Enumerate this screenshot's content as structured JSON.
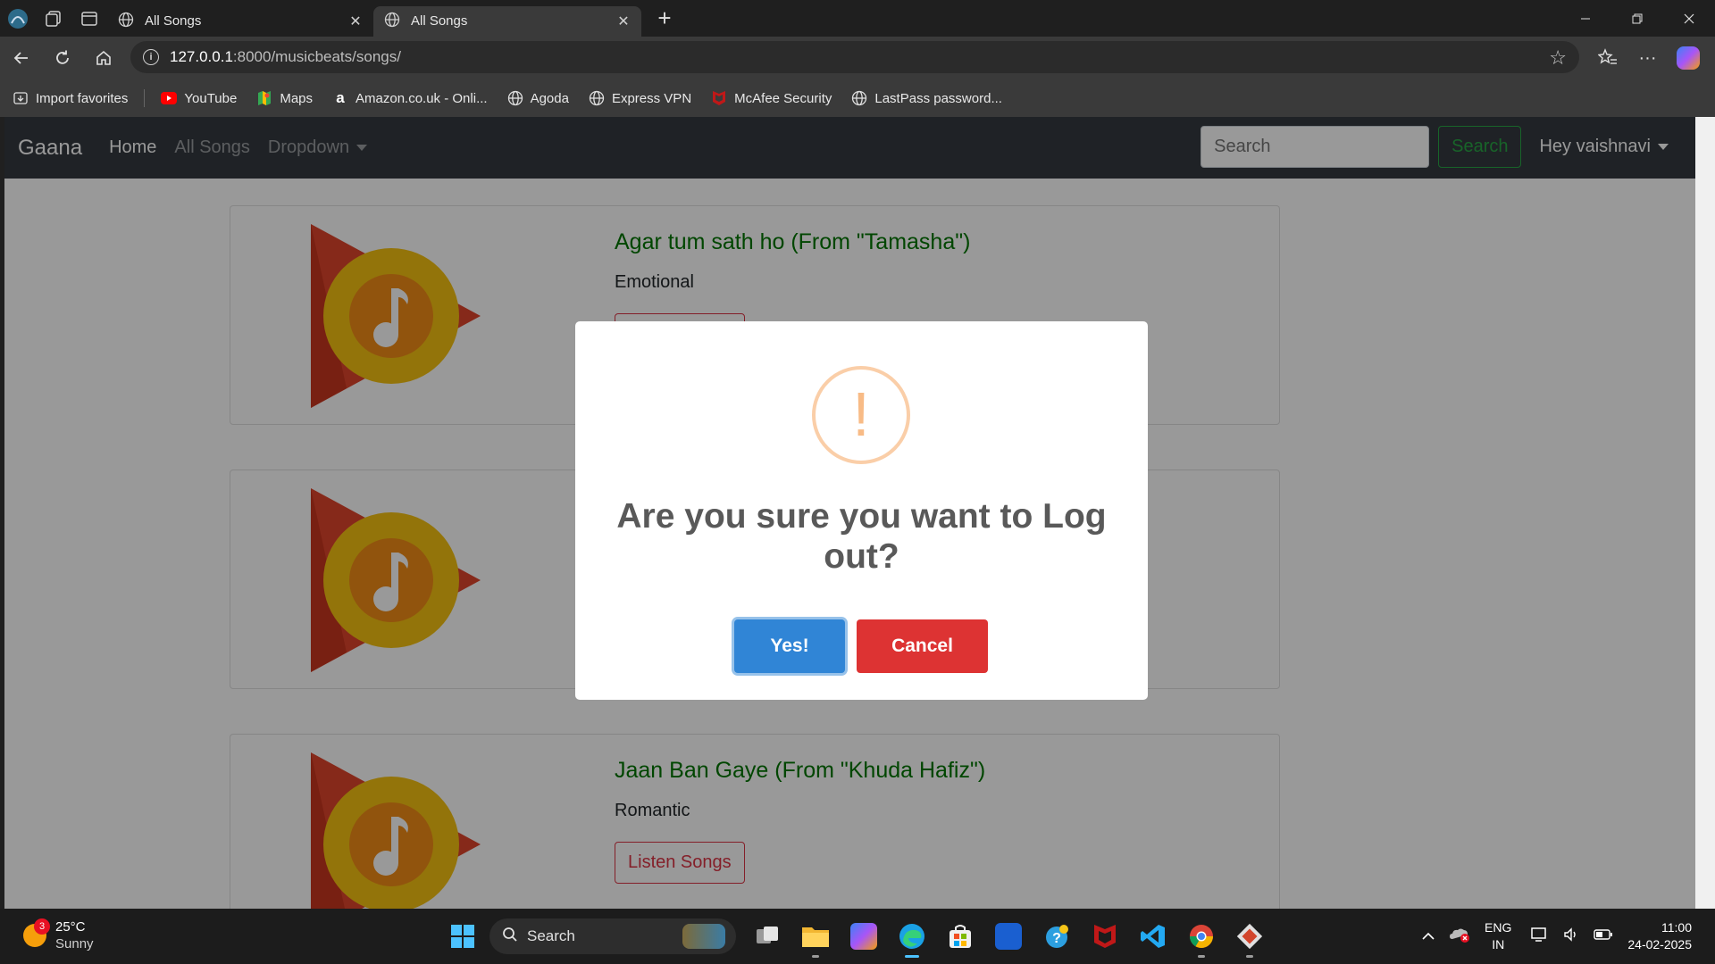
{
  "browser": {
    "tabs": [
      {
        "title": "All Songs",
        "close": "✕"
      },
      {
        "title": "All Songs",
        "close": "✕"
      }
    ],
    "new_tab": "+",
    "url_host": "127.0.0.1",
    "url_path": ":8000/musicbeats/songs/",
    "favorites": [
      {
        "label": "Import favorites",
        "icon": "import-icon"
      },
      {
        "label": "YouTube",
        "icon": "youtube-icon"
      },
      {
        "label": "Maps",
        "icon": "maps-icon"
      },
      {
        "label": "Amazon.co.uk - Onli...",
        "icon": "amazon-icon"
      },
      {
        "label": "Agoda",
        "icon": "globe-icon"
      },
      {
        "label": "Express VPN",
        "icon": "globe-icon"
      },
      {
        "label": "McAfee Security",
        "icon": "mcafee-icon"
      },
      {
        "label": "LastPass password...",
        "icon": "globe-icon"
      }
    ]
  },
  "navbar": {
    "brand": "Gaana",
    "links": [
      "Home",
      "All Songs",
      "Dropdown"
    ],
    "search_placeholder": "Search",
    "search_button": "Search",
    "user_menu": "Hey vaishnavi"
  },
  "songs": [
    {
      "title": "Agar tum sath ho (From \"Tamasha\")",
      "genre": "Emotional",
      "button": "Listen Songs"
    },
    {
      "title": "",
      "genre": "",
      "button": ""
    },
    {
      "title": "Jaan Ban Gaye (From \"Khuda Hafiz\")",
      "genre": "Romantic",
      "button": "Listen Songs"
    }
  ],
  "modal": {
    "icon": "!",
    "title": "Are you sure you want to Log out?",
    "confirm": "Yes!",
    "cancel": "Cancel"
  },
  "taskbar": {
    "weather_badge": "3",
    "temperature": "25°C",
    "condition": "Sunny",
    "search_label": "Search",
    "lang_top": "ENG",
    "lang_bottom": "IN",
    "time": "11:00",
    "date": "24-02-2025"
  },
  "colors": {
    "navbar_bg": "#343a40",
    "song_title": "#007500",
    "confirm_btn": "#3085d6",
    "cancel_btn": "#dd3333",
    "warning_icon": "#f8bb86"
  }
}
